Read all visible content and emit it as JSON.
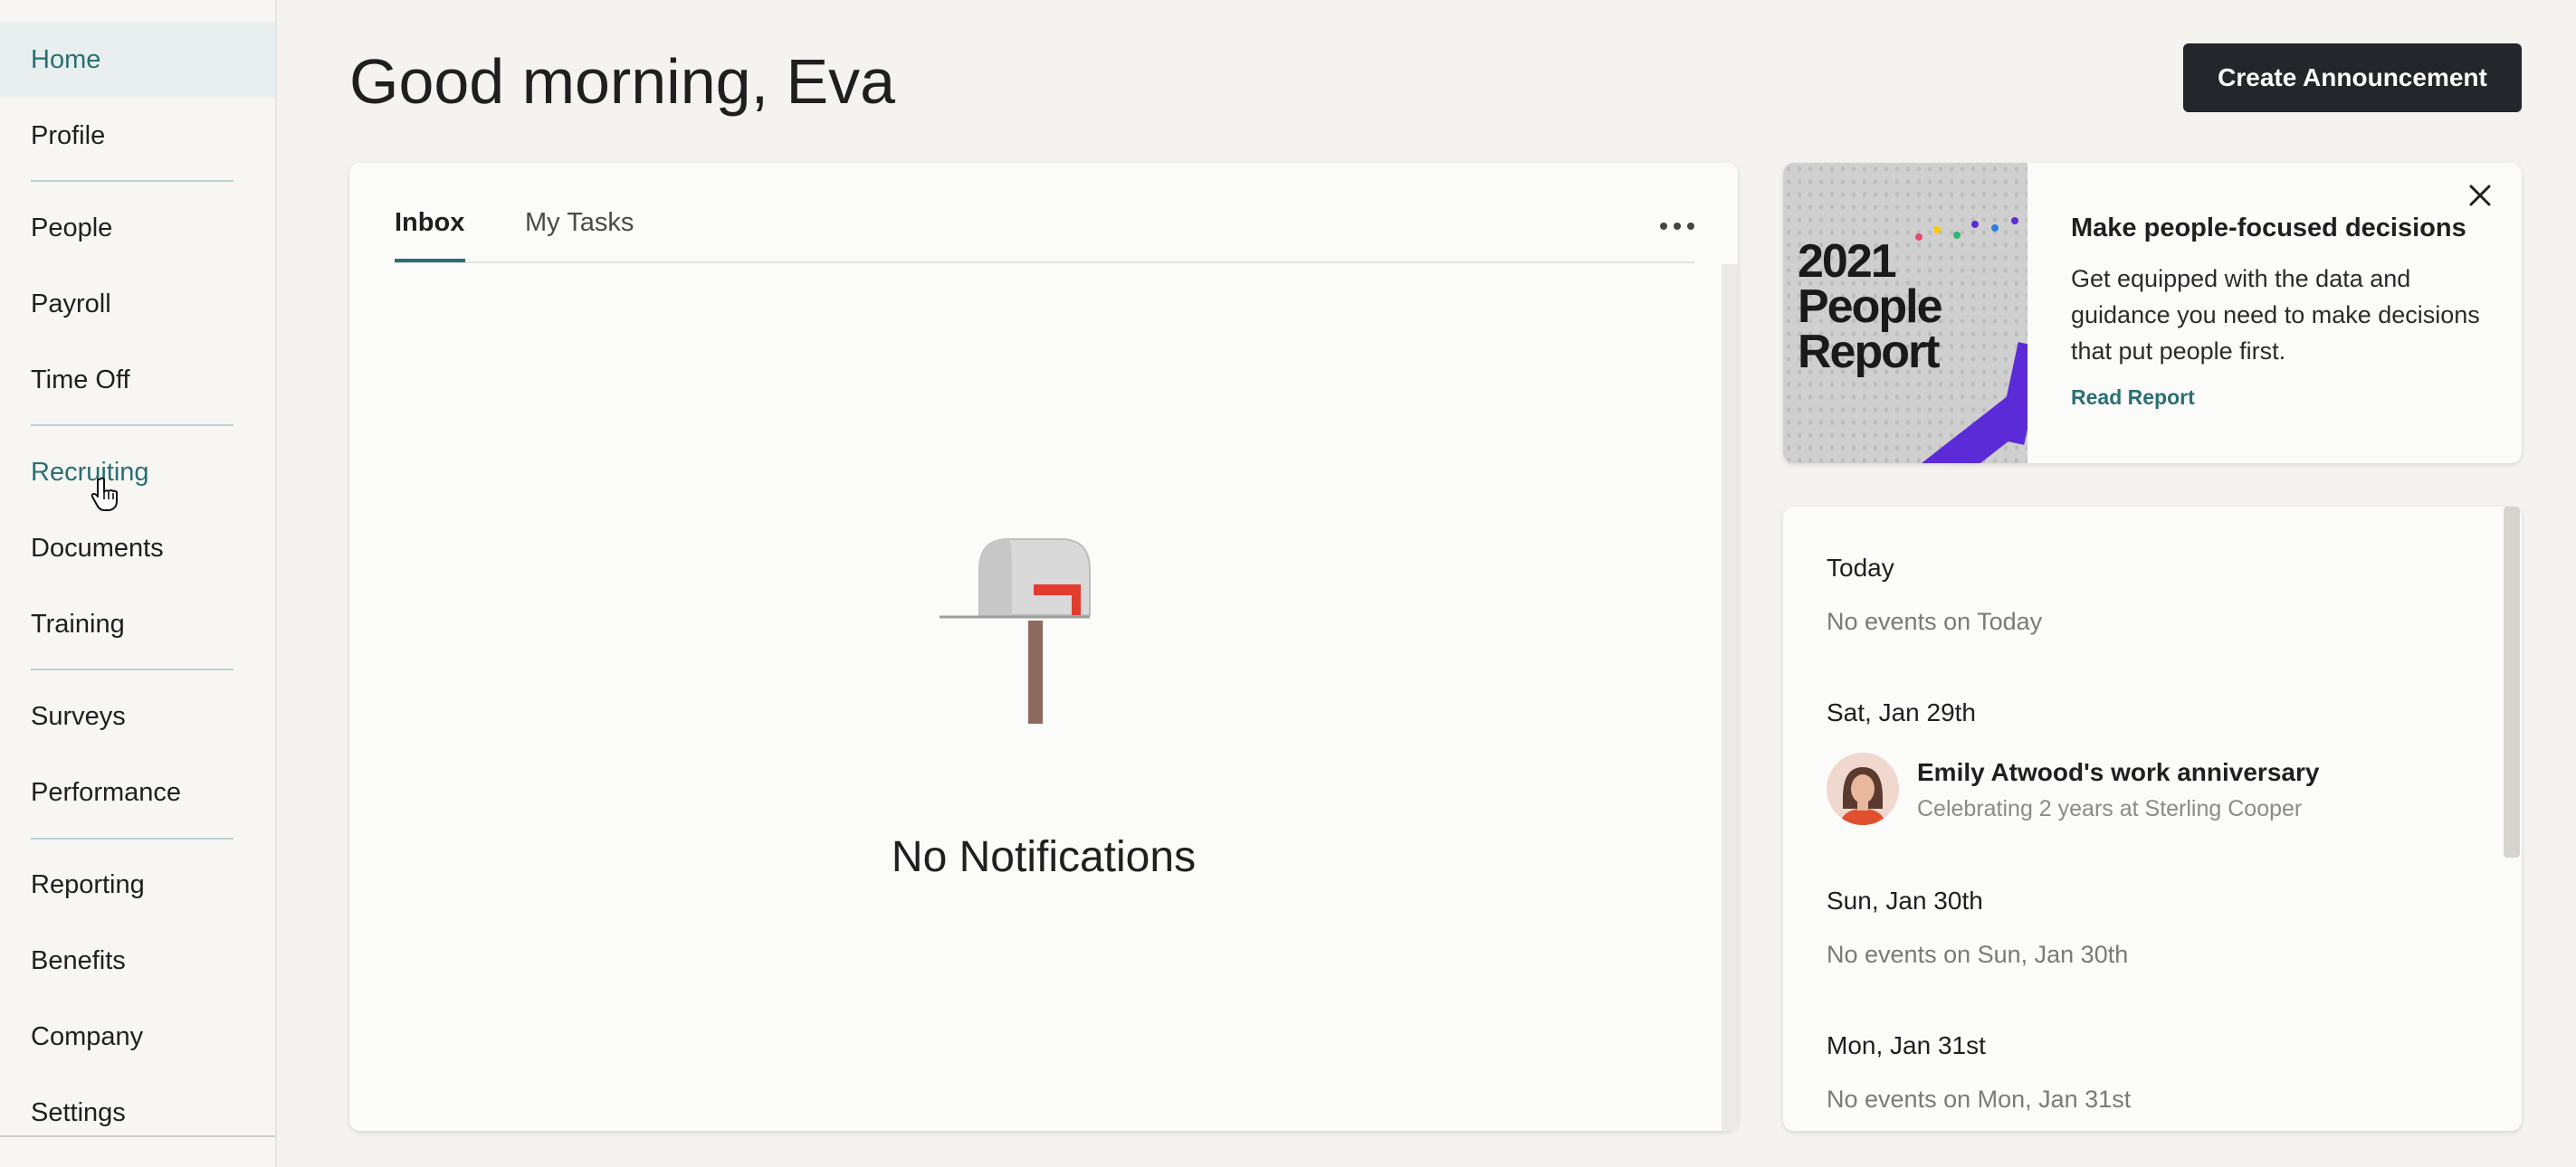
{
  "sidebar": {
    "items": [
      {
        "label": "Home"
      },
      {
        "label": "Profile"
      },
      {
        "label": "People"
      },
      {
        "label": "Payroll"
      },
      {
        "label": "Time Off"
      },
      {
        "label": "Recruiting"
      },
      {
        "label": "Documents"
      },
      {
        "label": "Training"
      },
      {
        "label": "Surveys"
      },
      {
        "label": "Performance"
      },
      {
        "label": "Reporting"
      },
      {
        "label": "Benefits"
      },
      {
        "label": "Company"
      },
      {
        "label": "Settings"
      }
    ],
    "active": "Home",
    "hovered": "Recruiting"
  },
  "header": {
    "greeting": "Good morning, Eva",
    "create_button_label": "Create Announcement"
  },
  "inbox": {
    "tabs": [
      {
        "label": "Inbox"
      },
      {
        "label": "My Tasks"
      }
    ],
    "selected_tab": "Inbox",
    "empty_text": "No Notifications",
    "empty_icon": "mailbox-icon"
  },
  "promo": {
    "image_text": [
      "2021",
      "People",
      "Report"
    ],
    "title": "Make people-focused decisions",
    "body": "Get equipped with the data and guidance you need to make decisions that put people first.",
    "link": "Read Report"
  },
  "events": {
    "today": {
      "date": "Today",
      "empty": "No events on Today"
    },
    "jan29": {
      "date": "Sat, Jan 29th",
      "title": "Emily Atwood's work anniversary",
      "subtitle": "Celebrating 2 years at Sterling Cooper"
    },
    "jan30": {
      "date": "Sun, Jan 30th",
      "empty": "No events on Sun, Jan 30th"
    },
    "jan31": {
      "date": "Mon, Jan 31st",
      "empty": "No events on Mon, Jan 31st"
    }
  },
  "colors": {
    "accent": "#2a6f73",
    "button_dark": "#23262a",
    "promo_purple": "#5b2bd8"
  }
}
